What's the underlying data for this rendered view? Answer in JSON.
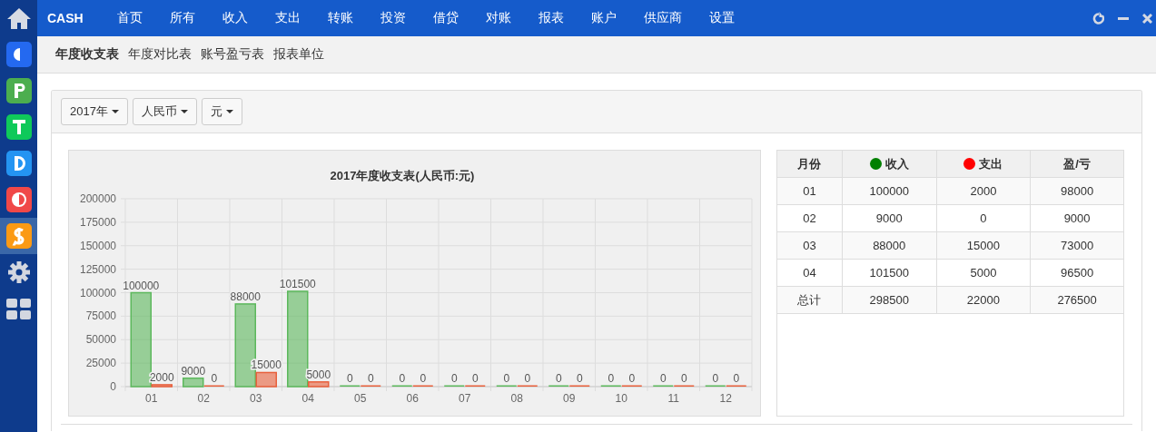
{
  "sidebar": {
    "items": [
      {
        "color": "#2469f0",
        "selected": false
      },
      {
        "color": "#4cae4f",
        "selected": false
      },
      {
        "color": "#0fc95a",
        "selected": false
      },
      {
        "color": "#2494f2",
        "selected": false
      },
      {
        "color": "#f04848",
        "selected": false
      },
      {
        "color": "#fb9a14",
        "selected": true
      }
    ]
  },
  "top_nav": {
    "brand": "CASH",
    "items": [
      "首页",
      "所有",
      "收入",
      "支出",
      "转账",
      "投资",
      "借贷",
      "对账",
      "报表",
      "账户",
      "供应商",
      "设置"
    ]
  },
  "tabs": [
    {
      "label": "年度收支表",
      "selected": true
    },
    {
      "label": "年度对比表",
      "selected": false
    },
    {
      "label": "账号盈亏表",
      "selected": false
    },
    {
      "label": "报表单位",
      "selected": false
    }
  ],
  "filters": [
    "2017年",
    "人民币",
    "元"
  ],
  "chart_data": {
    "type": "bar",
    "title": "2017年度收支表(人民币:元)",
    "categories": [
      "01",
      "02",
      "03",
      "04",
      "05",
      "06",
      "07",
      "08",
      "09",
      "10",
      "11",
      "12"
    ],
    "series": [
      {
        "color": "#5cb85c",
        "values": [
          100000,
          9000,
          88000,
          101500,
          0,
          0,
          0,
          0,
          0,
          0,
          0,
          0
        ]
      },
      {
        "color": "#e8603c",
        "values": [
          2000,
          0,
          15000,
          5000,
          0,
          0,
          0,
          0,
          0,
          0,
          0,
          0
        ]
      }
    ],
    "ylim": [
      0,
      200000
    ],
    "yticks": [
      0,
      25000,
      50000,
      75000,
      100000,
      125000,
      150000,
      175000,
      200000
    ],
    "data_labels": true,
    "grid": true
  },
  "table": {
    "columns": [
      {
        "label": "月份"
      },
      {
        "label": "收入",
        "color": "#008000"
      },
      {
        "label": "支出",
        "color": "#ff0000"
      },
      {
        "label": "盈/亏"
      }
    ],
    "rows": [
      [
        "01",
        "100000",
        "2000",
        "98000"
      ],
      [
        "02",
        "9000",
        "0",
        "9000"
      ],
      [
        "03",
        "88000",
        "15000",
        "73000"
      ],
      [
        "04",
        "101500",
        "5000",
        "96500"
      ],
      [
        "总计",
        "298500",
        "22000",
        "276500"
      ]
    ]
  }
}
